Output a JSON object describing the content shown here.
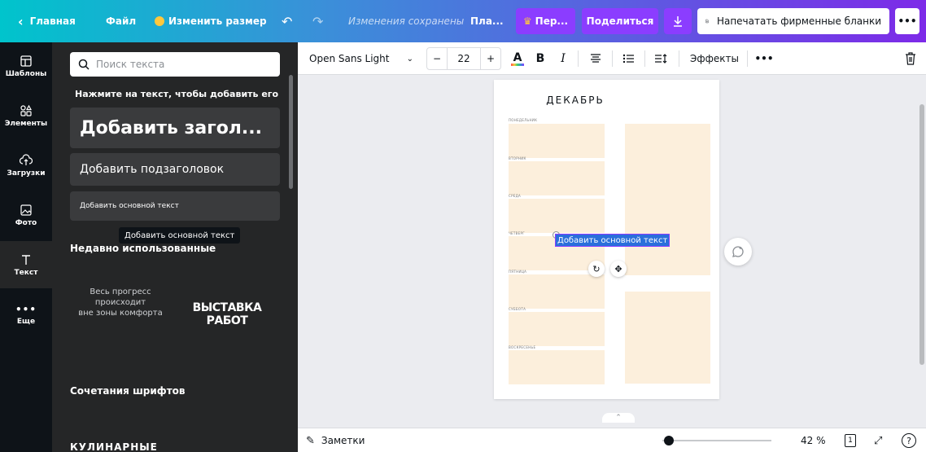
{
  "topbar": {
    "home": "Главная",
    "file": "Файл",
    "resize": "Изменить размер",
    "saved_status": "Изменения сохранены",
    "plan_button": "Пла...",
    "premium_button": "Пер...",
    "share_button": "Поделиться",
    "print_button": "Напечатать фирменные бланки",
    "more": "•••"
  },
  "rail": {
    "items": [
      {
        "label": "Шаблоны",
        "icon": "template-icon"
      },
      {
        "label": "Элементы",
        "icon": "elements-icon"
      },
      {
        "label": "Загрузки",
        "icon": "upload-icon"
      },
      {
        "label": "Фото",
        "icon": "photo-icon"
      },
      {
        "label": "Текст",
        "icon": "text-icon"
      },
      {
        "label": "Еще",
        "icon": "more-icon"
      }
    ]
  },
  "panel": {
    "search_placeholder": "Поиск текста",
    "hint": "Нажмите на текст, чтобы добавить его",
    "add_heading": "Добавить загол...",
    "add_subheading": "Добавить подзаголовок",
    "add_body": "Добавить основной текст",
    "tooltip": "Добавить основной текст",
    "recent_title": "Недавно использованные",
    "sample1_line1": "Весь прогресс",
    "sample1_line2": "происходит",
    "sample1_line3": "вне зоны комфорта",
    "sample2_title": "ВЫСТАВКА РАБОТ",
    "combos_title": "Сочетания шрифтов",
    "combo1": "КУЛИНАРНЫЕ"
  },
  "toolbar": {
    "font_family": "Open Sans Light",
    "font_size": "22",
    "bold": "B",
    "italic": "I",
    "effects": "Эффекты",
    "more": "•••"
  },
  "canvas": {
    "title": "ДЕКАБРЬ",
    "days": [
      "ПОНЕДЕЛЬНИК",
      "ВТОРНИК",
      "СРЕДА",
      "ЧЕТВЕРГ",
      "ПЯТНИЦА",
      "СУББОТА",
      "ВОСКРЕСЕНЬЕ"
    ],
    "selected_text": "Добавить основной текст"
  },
  "bottombar": {
    "notes": "Заметки",
    "zoom": "42 %",
    "page_number": "1",
    "help": "?"
  },
  "colors": {
    "accent_purple": "#8b3dff",
    "panel_bg": "#252627",
    "rail_bg": "#0e1318",
    "day_fill": "#fcefdc",
    "selection_blue": "#2a6fdb"
  }
}
